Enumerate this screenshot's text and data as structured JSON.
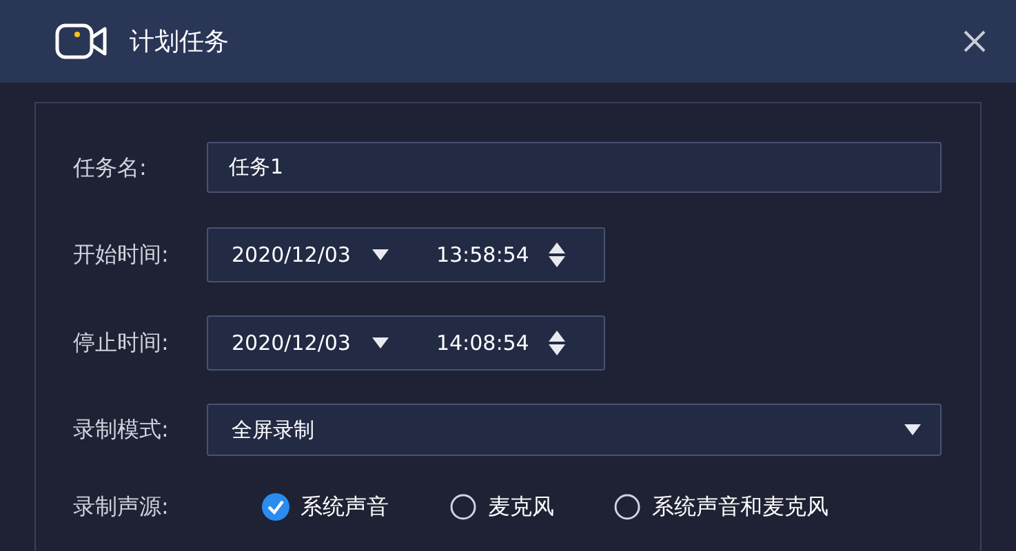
{
  "window": {
    "title": "计划任务"
  },
  "task_name": {
    "label": "任务名:",
    "value": "任务1"
  },
  "start_time": {
    "label": "开始时间:",
    "date": "2020/12/03",
    "time": "13:58:54"
  },
  "stop_time": {
    "label": "停止时间:",
    "date": "2020/12/03",
    "time": "14:08:54"
  },
  "record_mode": {
    "label": "录制模式:",
    "value": "全屏录制"
  },
  "audio_source": {
    "label": "录制声源:",
    "options": [
      {
        "label": "系统声音",
        "selected": true
      },
      {
        "label": "麦克风",
        "selected": false
      },
      {
        "label": "系统声音和麦克风",
        "selected": false
      }
    ]
  }
}
